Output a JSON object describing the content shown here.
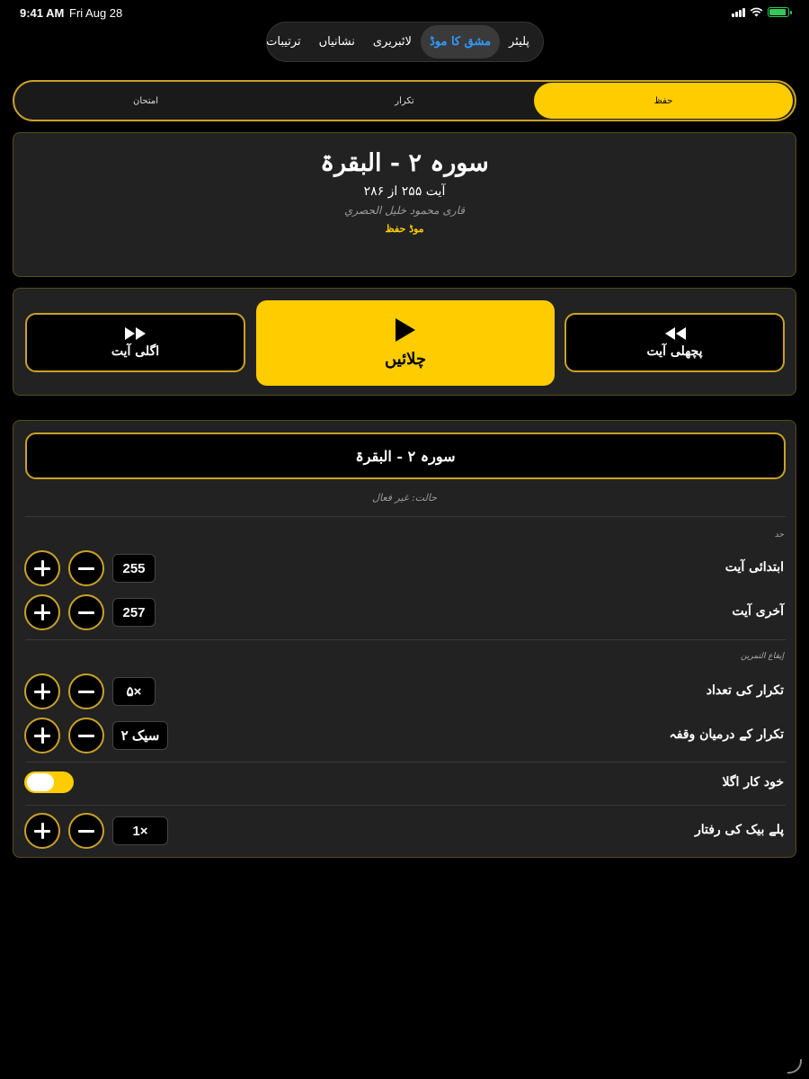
{
  "status_bar": {
    "time": "9:41 AM",
    "date": "Fri Aug 28",
    "signal_icon": "cellular-signal-icon",
    "wifi_icon": "wifi-icon",
    "battery_icon": "battery-charging-icon",
    "battery_color": "#34c759"
  },
  "top_nav": {
    "items": [
      {
        "label": "پلیئر",
        "active": false
      },
      {
        "label": "مشق کا موڈ",
        "active": true
      },
      {
        "label": "لائبریری",
        "active": false
      },
      {
        "label": "نشانیاں",
        "active": false
      },
      {
        "label": "ترتیبات",
        "active": false
      }
    ],
    "active_color": "#2f9bff"
  },
  "mode_tabs": {
    "items": [
      {
        "label": "حفظ",
        "active": true
      },
      {
        "label": "تکرار",
        "active": false
      },
      {
        "label": "امتحان",
        "active": false
      }
    ],
    "accent": "#ffcc00"
  },
  "now_playing": {
    "surah_title": "سورہ ۲ - البقرۃ",
    "ayah_count": "آیت ۲۵۵ از ۲۸۶",
    "reciter": "قاری محمود خلیل الحصري",
    "mode": "موڈ حفظ"
  },
  "controls": {
    "next": {
      "label": "اگلی آیت",
      "icon": "fast-forward-icon"
    },
    "play": {
      "label": "چلائیں",
      "icon": "play-icon"
    },
    "prev": {
      "label": "پچھلی آیت",
      "icon": "rewind-icon"
    }
  },
  "settings": {
    "surah_select": "سورہ ۲ - البقرۃ",
    "status": "حالت: غیر فعال",
    "range_section": "حد",
    "start_ayah": {
      "label": "ابتدائی آیت",
      "value": "255"
    },
    "end_ayah": {
      "label": "آخری آیت",
      "value": "257"
    },
    "rhythm_section": "إيقاع التمرين",
    "repeat_count": {
      "label": "تکرار کی تعداد",
      "value": "۵×"
    },
    "repeat_gap": {
      "label": "تکرار کے درمیان وقفہ",
      "value": "۲ سیک"
    },
    "auto_next": {
      "label": "خود کار اگلا",
      "on": true
    },
    "playback_speed": {
      "label": "پلے بیک کی رفتار",
      "value": "1×"
    }
  }
}
